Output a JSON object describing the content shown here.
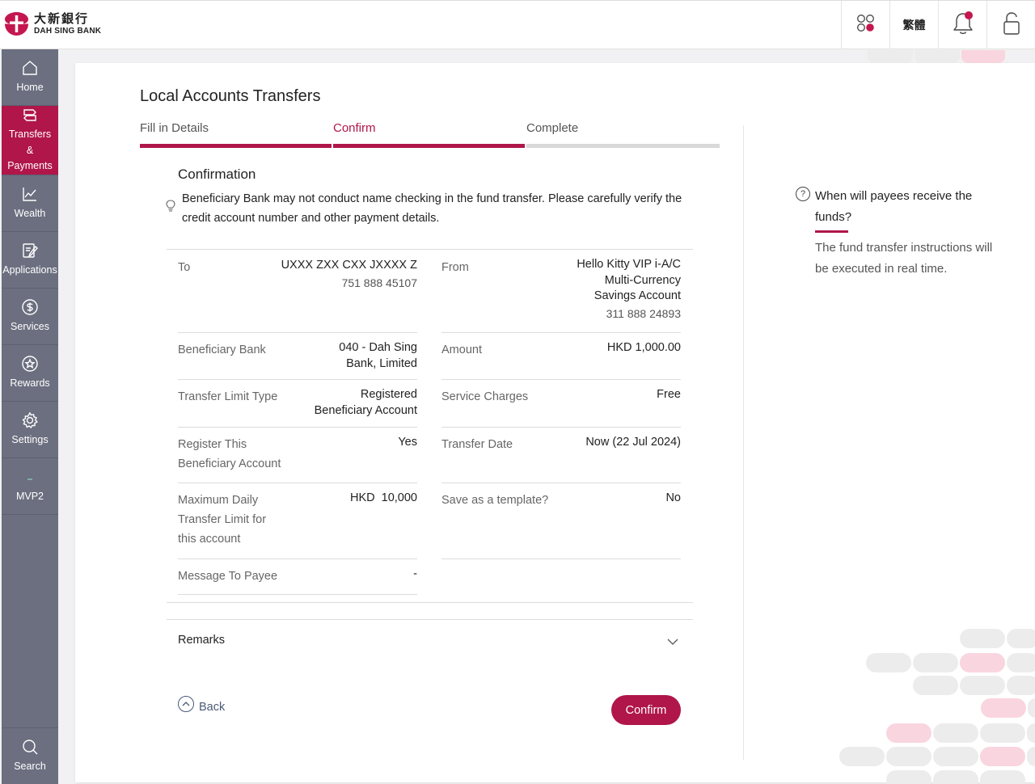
{
  "brand": {
    "name_cn": "大新銀行",
    "name_en": "DAH SING BANK",
    "primary_color": "#b0164a"
  },
  "topbar": {
    "apps_icon": "apps-grid-icon",
    "language_label": "繁體",
    "notification_icon": "bell-icon",
    "lock_icon": "lock-icon"
  },
  "sidebar": {
    "items": [
      {
        "label": "Home",
        "icon": "home-icon"
      },
      {
        "label": "Transfers & Payments",
        "icon": "transfer-icon",
        "active": true
      },
      {
        "label": "Wealth",
        "icon": "chart-icon"
      },
      {
        "label": "Applications",
        "icon": "edit-icon"
      },
      {
        "label": "Services",
        "icon": "dollar-icon"
      },
      {
        "label": "Rewards",
        "icon": "star-icon"
      },
      {
        "label": "Settings",
        "icon": "gear-icon"
      },
      {
        "label": "MVP2",
        "icon": "dash-icon"
      },
      {
        "label": "Search",
        "icon": "search-icon"
      }
    ]
  },
  "page": {
    "title": "Local Accounts Transfers",
    "steps": [
      {
        "label": "Fill in Details",
        "status": "done"
      },
      {
        "label": "Confirm",
        "status": "current"
      },
      {
        "label": "Complete",
        "status": "pending"
      }
    ],
    "confirmation_title": "Confirmation",
    "notice": "Beneficiary Bank may not conduct name checking in the fund transfer. Please carefully verify the credit account number and other payment details."
  },
  "details": {
    "to_label": "To",
    "to_name": "UXXX ZXX CXX JXXXX Z",
    "to_account": "751 888 45107",
    "from_label": "From",
    "from_name_1": "Hello Kitty VIP i-A/C",
    "from_name_2": "Multi-Currency",
    "from_name_3": "Savings Account",
    "from_account": "311 888 24893",
    "beneficiary_bank_label": "Beneficiary Bank",
    "beneficiary_bank_1": "040 - Dah Sing",
    "beneficiary_bank_2": "Bank, Limited",
    "amount_label": "Amount",
    "amount": "HKD 1,000.00",
    "limit_type_label": "Transfer Limit Type",
    "limit_type_1": "Registered",
    "limit_type_2": "Beneficiary Account",
    "charges_label": "Service Charges",
    "charges": "Free",
    "register_label_1": "Register This",
    "register_label_2": "Beneficiary Account",
    "register": "Yes",
    "date_label": "Transfer Date",
    "date": "Now (22 Jul 2024)",
    "max_limit_label_1": "Maximum Daily",
    "max_limit_label_2": "Transfer Limit for",
    "max_limit_label_3": "this account",
    "max_limit": "HKD  10,000",
    "template_label": "Save as a template?",
    "template": "No",
    "message_label": "Message To Payee",
    "message": "-"
  },
  "remarks_label": "Remarks",
  "actions": {
    "back_label": "Back",
    "confirm_label": "Confirm"
  },
  "faq": {
    "question": "When will payees receive the funds?",
    "answer": "The fund transfer instructions will be executed in real time."
  }
}
